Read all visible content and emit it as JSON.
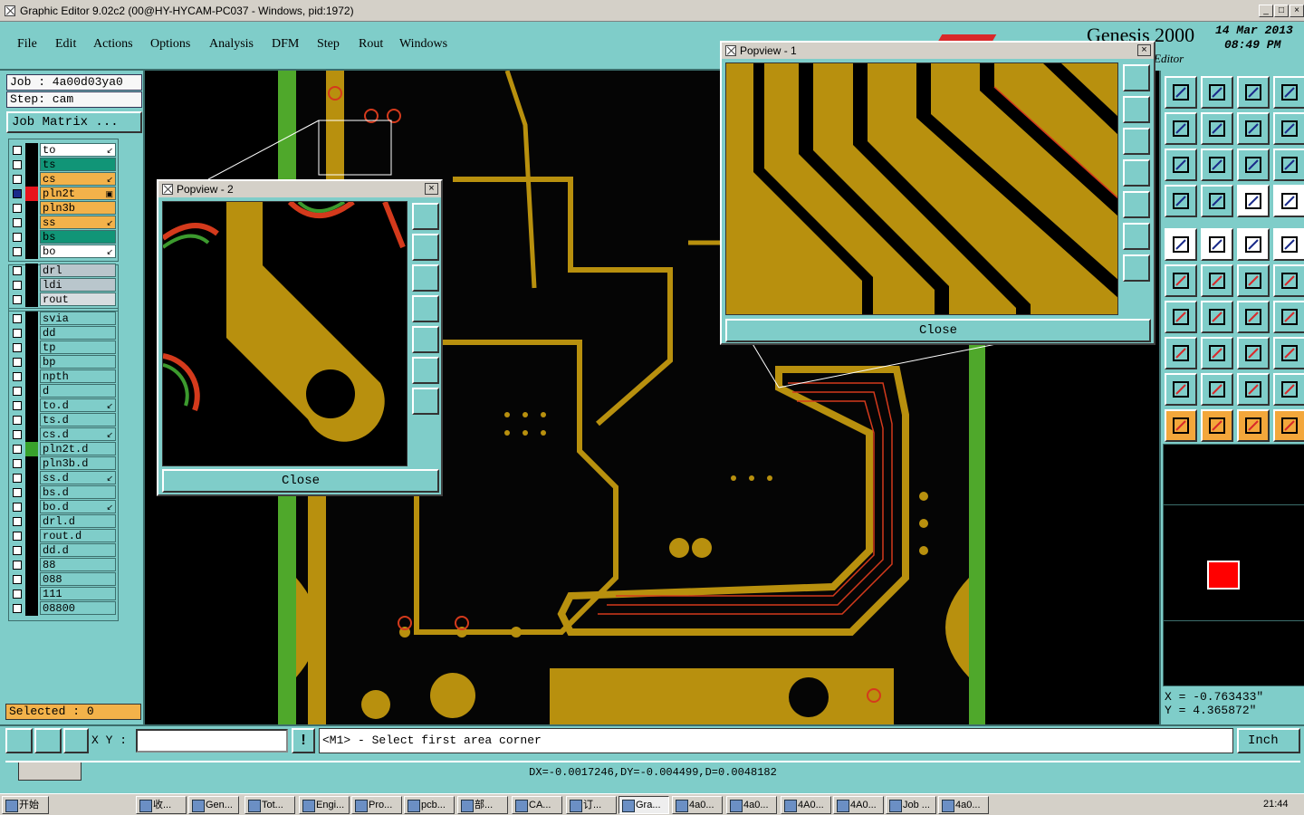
{
  "window": {
    "title": "Graphic Editor 9.02c2 (00@HY-HYCAM-PC037 - Windows, pid:1972)",
    "minimize_label": "_",
    "maximize_label": "□",
    "close_label": "×"
  },
  "menu": [
    "File",
    "Edit",
    "Actions",
    "Options",
    "Analysis",
    "DFM",
    "Step",
    "Rout",
    "Windows"
  ],
  "brand": {
    "product": "Genesis 2000",
    "subtitle": "Editor",
    "date": "14 Mar 2013",
    "time": "08:49 PM"
  },
  "job_info": {
    "job": "Job  : 4a00d03ya0",
    "step": "Step: cam",
    "job_matrix_button": "Job Matrix ..."
  },
  "layers_group1": [
    {
      "name": "to",
      "color": "#ffffff",
      "arrow": "↙"
    },
    {
      "name": "ts",
      "color": "#119577",
      "arrow": ""
    },
    {
      "name": "cs",
      "color": "#f3b24a",
      "arrow": "↙"
    },
    {
      "name": "pln2t",
      "color": "#f3b24a",
      "arrow": "▣",
      "selected": true
    },
    {
      "name": "pln3b",
      "color": "#f3b24a",
      "arrow": ""
    },
    {
      "name": "ss",
      "color": "#f3b24a",
      "arrow": "↙"
    },
    {
      "name": "bs",
      "color": "#119577",
      "arrow": ""
    },
    {
      "name": "bo",
      "color": "#ffffff",
      "arrow": "↙"
    }
  ],
  "layers_group2": [
    {
      "name": "drl",
      "color": "#b9c6cc"
    },
    {
      "name": "ldi",
      "color": "#b9c6cc"
    },
    {
      "name": "rout",
      "color": "#d7dde0"
    }
  ],
  "layers_group3": [
    {
      "name": "svia",
      "arrow": ""
    },
    {
      "name": "dd",
      "arrow": ""
    },
    {
      "name": "tp",
      "arrow": ""
    },
    {
      "name": "bp",
      "arrow": ""
    },
    {
      "name": "npth",
      "arrow": ""
    },
    {
      "name": "d",
      "arrow": ""
    },
    {
      "name": "to.d",
      "arrow": "↙"
    },
    {
      "name": "ts.d",
      "arrow": ""
    },
    {
      "name": "cs.d",
      "arrow": "↙"
    },
    {
      "name": "pln2t.d",
      "arrow": ""
    },
    {
      "name": "pln3b.d",
      "arrow": ""
    },
    {
      "name": "ss.d",
      "arrow": "↙"
    },
    {
      "name": "bs.d",
      "arrow": ""
    },
    {
      "name": "bo.d",
      "arrow": "↙"
    },
    {
      "name": "drl.d",
      "arrow": ""
    },
    {
      "name": "rout.d",
      "arrow": ""
    },
    {
      "name": "dd.d",
      "arrow": ""
    },
    {
      "name": "88",
      "arrow": ""
    },
    {
      "name": "088",
      "arrow": ""
    },
    {
      "name": "111",
      "arrow": ""
    },
    {
      "name": "08800",
      "arrow": ""
    }
  ],
  "selected_count": "Selected : 0",
  "popview1": {
    "title": "Popview - 1",
    "close": "Close"
  },
  "popview2": {
    "title": "Popview - 2",
    "close": "Close"
  },
  "coords": {
    "x": "X  = -0.763433\"",
    "y": "Y  = 4.365872\""
  },
  "command": {
    "xy_label": "X Y :",
    "xy_value": "",
    "prompt": "<M1> - Select first area corner",
    "units": "Inch"
  },
  "status": "DX=-0.0017246,DY=-0.004499,D=0.0048182",
  "taskbar": {
    "start": "开始",
    "clock": "21:44",
    "tasks": [
      "收...",
      "Gen...",
      "Tot...",
      "Engi...",
      "Pro...",
      "pcb...",
      "部...",
      "CA...",
      "订...",
      "Gra...",
      "4a0...",
      "4a0...",
      "4A0...",
      "4A0...",
      "Job ...",
      "4a0..."
    ]
  }
}
